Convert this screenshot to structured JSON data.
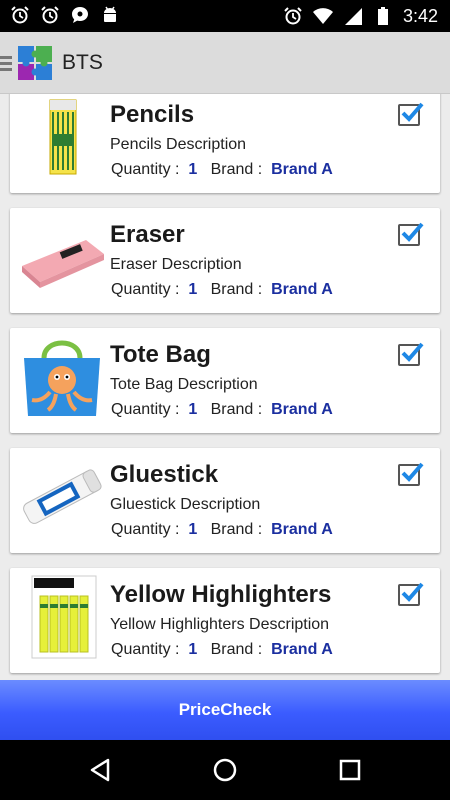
{
  "status_bar": {
    "time": "3:42",
    "left_icons": [
      "alarm-icon",
      "alarm-icon",
      "chat-bubble-icon",
      "android-icon"
    ],
    "right_icons": [
      "alarm-icon",
      "wifi-icon",
      "signal-icon",
      "battery-icon"
    ]
  },
  "app_bar": {
    "title": "BTS",
    "logo": "puzzle-logo-icon"
  },
  "products": [
    {
      "name": "Pencils",
      "description": "Pencils Description",
      "quantity_label": "Quantity :",
      "quantity": "1",
      "brand_label": "Brand :",
      "brand": "Brand A",
      "checked": true,
      "image": "pencils-image"
    },
    {
      "name": "Eraser",
      "description": "Eraser Description",
      "quantity_label": "Quantity :",
      "quantity": "1",
      "brand_label": "Brand :",
      "brand": "Brand A",
      "checked": true,
      "image": "eraser-image"
    },
    {
      "name": "Tote Bag",
      "description": "Tote Bag Description",
      "quantity_label": "Quantity :",
      "quantity": "1",
      "brand_label": "Brand :",
      "brand": "Brand A",
      "checked": true,
      "image": "tote-bag-image"
    },
    {
      "name": "Gluestick",
      "description": "Gluestick Description",
      "quantity_label": "Quantity :",
      "quantity": "1",
      "brand_label": "Brand :",
      "brand": "Brand A",
      "checked": true,
      "image": "gluestick-image"
    },
    {
      "name": "Yellow Highlighters",
      "description": "Yellow Highlighters Description",
      "quantity_label": "Quantity :",
      "quantity": "1",
      "brand_label": "Brand :",
      "brand": "Brand A",
      "checked": true,
      "image": "highlighters-image"
    }
  ],
  "price_check_label": "PriceCheck",
  "colors": {
    "accent": "#2f55ff",
    "value_text": "#1b2fa0",
    "checkbox_tick": "#1e88e5"
  },
  "nav_bar": {
    "icons": [
      "back-icon",
      "home-icon",
      "recents-icon"
    ]
  }
}
